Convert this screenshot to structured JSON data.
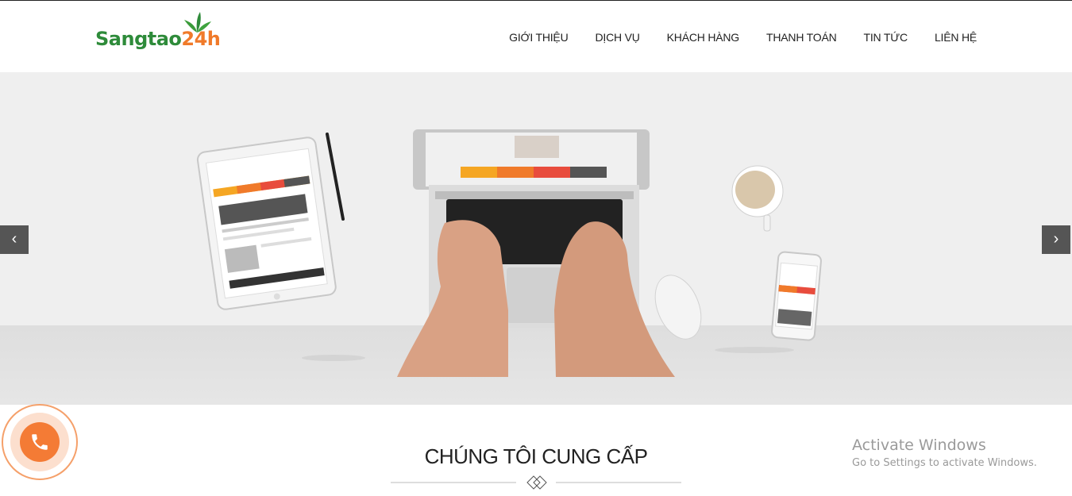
{
  "header": {
    "logo": {
      "part1": "Sangtao",
      "part2": "24h"
    },
    "nav": [
      "GIỚI THIỆU",
      "DỊCH VỤ",
      "KHÁCH HÀNG",
      "THANH TOÁN",
      "TIN TỨC",
      "LIÊN HỆ"
    ]
  },
  "slider": {
    "prev_label": "‹",
    "next_label": "›"
  },
  "section": {
    "title": "CHÚNG TÔI CUNG CẤP"
  },
  "watermark": {
    "title": "Activate Windows",
    "subtitle": "Go to Settings to activate Windows."
  },
  "colors": {
    "brand_green": "#2e8b3a",
    "brand_orange": "#f47b35",
    "arrow_bg": "#555555"
  },
  "icons": [
    "leaf-icon",
    "phone-icon",
    "chevron-left-icon",
    "chevron-right-icon",
    "diamond-divider-icon"
  ]
}
